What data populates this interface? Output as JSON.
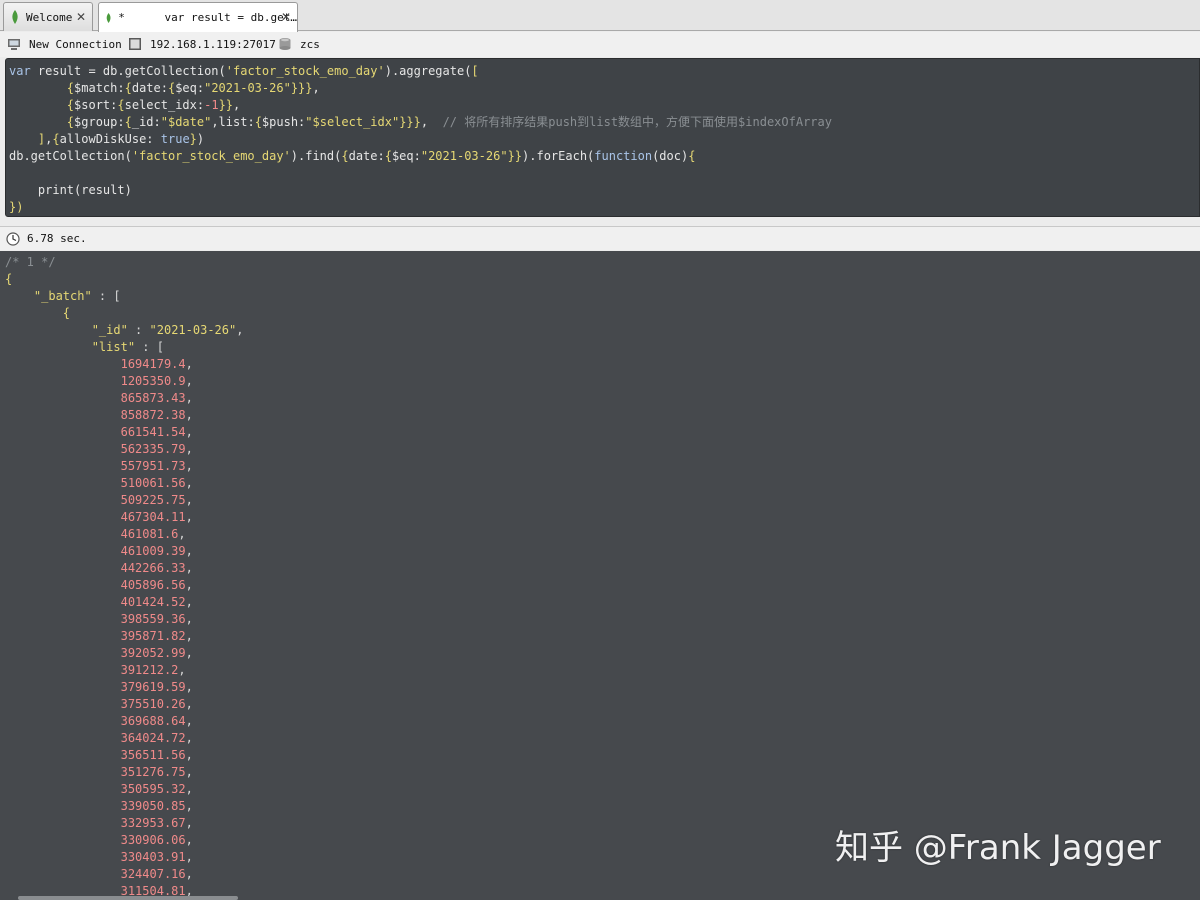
{
  "tabs": [
    {
      "label": "Welcome",
      "close": "✕"
    },
    {
      "label": "*      var result = db.get…",
      "close": "✕"
    }
  ],
  "connection": {
    "name": "New Connection",
    "host": "192.168.1.119:27017",
    "database": "zcs"
  },
  "editor": {
    "lines": [
      {
        "segments": [
          [
            "kw",
            "var"
          ],
          [
            "fn",
            " result = db.getCollection("
          ],
          [
            "str",
            "'factor_stock_emo_day'"
          ],
          [
            "fn",
            ").aggregate("
          ],
          [
            "op",
            "["
          ]
        ]
      },
      {
        "segments": [
          [
            "fn",
            "        "
          ],
          [
            "op",
            "{"
          ],
          [
            "fn",
            "$match:"
          ],
          [
            "op",
            "{"
          ],
          [
            "fn",
            "date:"
          ],
          [
            "op",
            "{"
          ],
          [
            "fn",
            "$eq:"
          ],
          [
            "str",
            "\"2021-03-26\""
          ],
          [
            "op",
            "}}}"
          ],
          [
            "fn",
            ","
          ]
        ]
      },
      {
        "segments": [
          [
            "fn",
            "        "
          ],
          [
            "op",
            "{"
          ],
          [
            "fn",
            "$sort:"
          ],
          [
            "op",
            "{"
          ],
          [
            "fn",
            "select_idx:"
          ],
          [
            "num",
            "-1"
          ],
          [
            "op",
            "}}"
          ],
          [
            "fn",
            ","
          ]
        ]
      },
      {
        "segments": [
          [
            "fn",
            "        "
          ],
          [
            "op",
            "{"
          ],
          [
            "fn",
            "$group:"
          ],
          [
            "op",
            "{"
          ],
          [
            "fn",
            "_id:"
          ],
          [
            "str",
            "\"$date\""
          ],
          [
            "fn",
            ",list:"
          ],
          [
            "op",
            "{"
          ],
          [
            "fn",
            "$push:"
          ],
          [
            "str",
            "\"$select_idx\""
          ],
          [
            "op",
            "}}}"
          ],
          [
            "fn",
            ",  "
          ],
          [
            "cm",
            "// 将所有排序结果push到list数组中，方便下面使用$indexOfArray"
          ]
        ]
      },
      {
        "segments": [
          [
            "fn",
            "    "
          ],
          [
            "op",
            "]"
          ],
          [
            "fn",
            ","
          ],
          [
            "op",
            "{"
          ],
          [
            "fn",
            "allowDiskUse: "
          ],
          [
            "kw",
            "true"
          ],
          [
            "op",
            "}"
          ],
          [
            "fn",
            ")"
          ]
        ]
      },
      {
        "segments": [
          [
            "fn",
            "db.getCollection("
          ],
          [
            "str",
            "'factor_stock_emo_day'"
          ],
          [
            "fn",
            ").find("
          ],
          [
            "op",
            "{"
          ],
          [
            "fn",
            "date:"
          ],
          [
            "op",
            "{"
          ],
          [
            "fn",
            "$eq:"
          ],
          [
            "str",
            "\"2021-03-26\""
          ],
          [
            "op",
            "}}"
          ],
          [
            "fn",
            ").forEach("
          ],
          [
            "kw",
            "function"
          ],
          [
            "fn",
            "(doc)"
          ],
          [
            "op",
            "{"
          ]
        ]
      },
      {
        "segments": [
          [
            "fn",
            ""
          ]
        ]
      },
      {
        "segments": [
          [
            "fn",
            "    print(result)"
          ]
        ]
      },
      {
        "segments": [
          [
            "op",
            "})"
          ]
        ]
      }
    ]
  },
  "status": {
    "time": "6.78 sec."
  },
  "result": {
    "comment": "/* 1 */",
    "open_brace": "{",
    "batch_key": "\"_batch\"",
    "array_open": " : [",
    "inner_open": "{",
    "id_key": "\"_id\"",
    "id_value": "\"2021-03-26\"",
    "list_key": "\"list\"",
    "values": [
      "1694179.4",
      "1205350.9",
      "865873.43",
      "858872.38",
      "661541.54",
      "562335.79",
      "557951.73",
      "510061.56",
      "509225.75",
      "467304.11",
      "461081.6",
      "461009.39",
      "442266.33",
      "405896.56",
      "401424.52",
      "398559.36",
      "395871.82",
      "392052.99",
      "391212.2",
      "379619.59",
      "375510.26",
      "369688.64",
      "364024.72",
      "356511.56",
      "351276.75",
      "350595.32",
      "339050.85",
      "332953.67",
      "330906.06",
      "330403.91",
      "324407.16",
      "311504.81"
    ]
  },
  "watermark": "知乎 @Frank Jagger",
  "colors": {
    "editor_bg": "#3f4347",
    "result_bg": "#46494d",
    "string": "#e6d874",
    "number": "#f08a8a",
    "keyword": "#a9c4e8"
  }
}
